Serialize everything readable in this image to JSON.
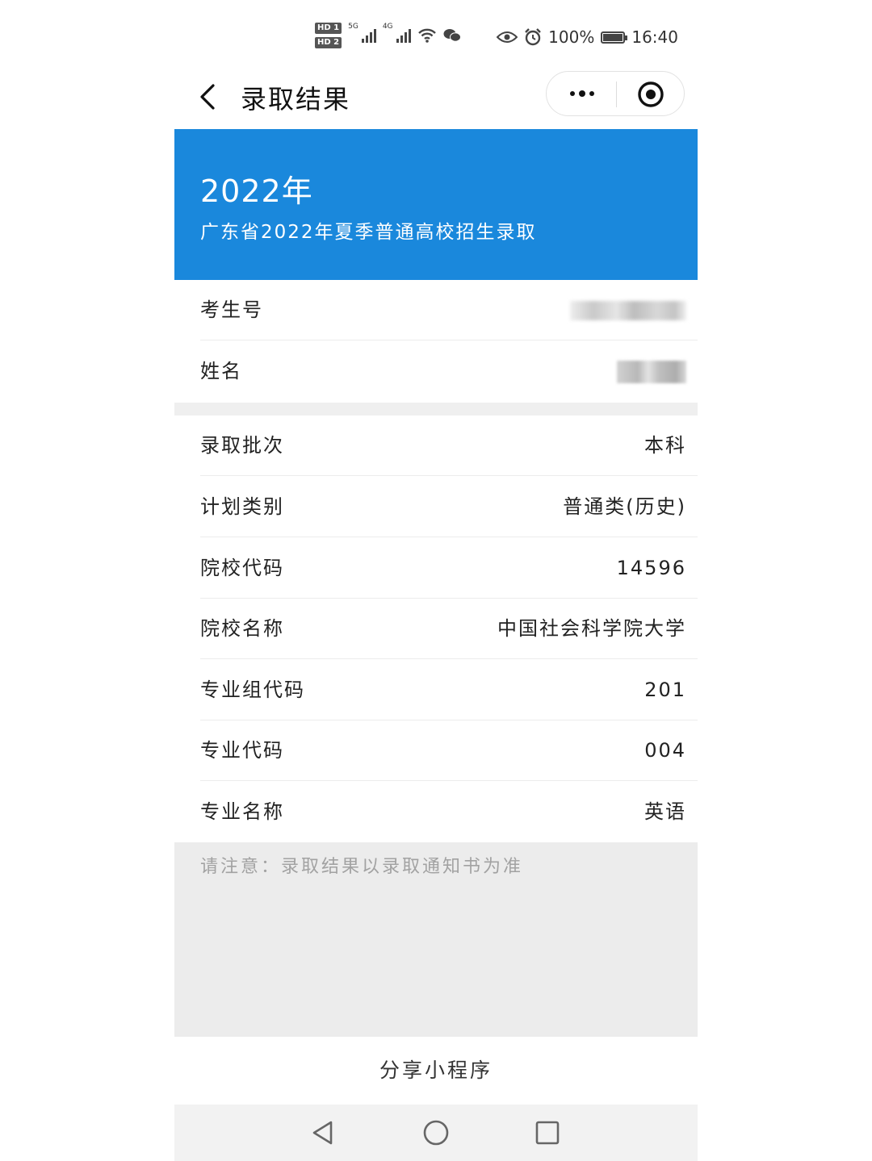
{
  "status_bar": {
    "hd1": "HD 1",
    "hd2": "HD 2",
    "net1": "5G",
    "net2": "4G",
    "battery": "100%",
    "time": "16:40"
  },
  "nav": {
    "title": "录取结果"
  },
  "banner": {
    "year": "2022年",
    "subtitle": "广东省2022年夏季普通高校招生录取"
  },
  "personal": [
    {
      "label": "考生号"
    },
    {
      "label": "姓名"
    }
  ],
  "details": [
    {
      "label": "录取批次",
      "value": "本科"
    },
    {
      "label": "计划类别",
      "value": "普通类(历史)"
    },
    {
      "label": "院校代码",
      "value": "14596"
    },
    {
      "label": "院校名称",
      "value": "中国社会科学院大学"
    },
    {
      "label": "专业组代码",
      "value": "201"
    },
    {
      "label": "专业代码",
      "value": "004"
    },
    {
      "label": "专业名称",
      "value": "英语"
    }
  ],
  "notice": "请注意：录取结果以录取通知书为准",
  "share_label": "分享小程序",
  "colors": {
    "banner": "#1a88dc",
    "notice_bg": "#ececec"
  }
}
